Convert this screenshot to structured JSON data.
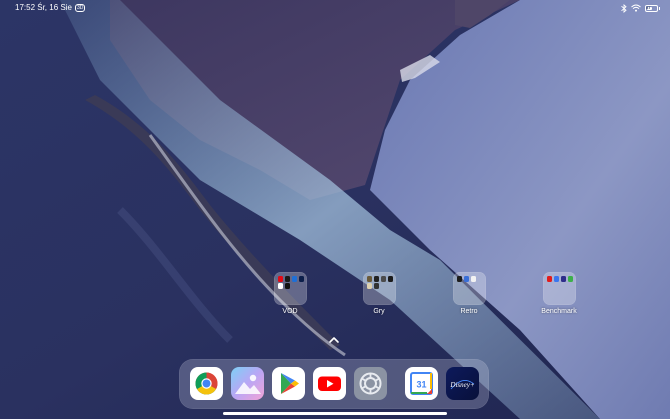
{
  "status_bar": {
    "time_date": "17:52 Śr, 16 Sie",
    "notification_badge": "3D",
    "battery_label": "57",
    "battery_level": 0.57,
    "icons": [
      "bluetooth-icon",
      "wifi-icon",
      "battery-icon"
    ]
  },
  "folders": [
    {
      "label": "VOD",
      "app_colors": [
        "#e50914",
        "#1a1a1a",
        "#1f6fd6",
        "#0c1f4a",
        "#ffffff",
        "#111111"
      ]
    },
    {
      "label": "Gry",
      "app_colors": [
        "#6a5a3a",
        "#222222",
        "#4b4b4b",
        "#1b1b1b",
        "#ddd0b0",
        "#333333"
      ]
    },
    {
      "label": "Retro",
      "app_colors": [
        "#1d1d1d",
        "#3a6fd8",
        "#f2f2f2"
      ]
    },
    {
      "label": "Benchmark",
      "app_colors": [
        "#e21c1c",
        "#3a76f0",
        "#2d2d8a",
        "#3db04a"
      ]
    }
  ],
  "dock": {
    "apps": [
      "chrome-icon",
      "gallery-icon",
      "play-store-icon",
      "youtube-icon",
      "settings-icon",
      "calendar-icon",
      "disney-plus-icon"
    ],
    "calendar_day": "31",
    "disney_text": "Disney+"
  }
}
